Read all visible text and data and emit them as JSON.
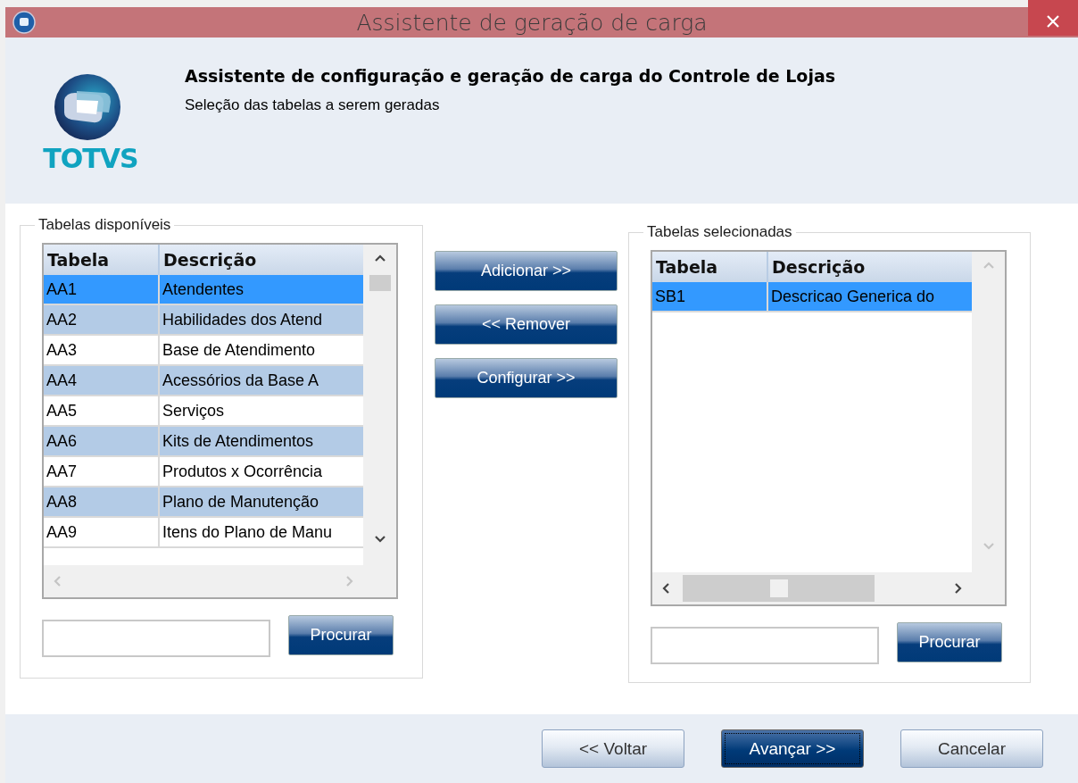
{
  "window": {
    "title": "Assistente de geração de carga"
  },
  "header": {
    "logo_text": "TOTVS",
    "title": "Assistente de configuração e geração de carga do Controle de Lojas",
    "subtitle": "Seleção das tabelas a serem geradas"
  },
  "available": {
    "label": "Tabelas disponíveis",
    "columns": [
      "Tabela",
      "Descrição"
    ],
    "rows": [
      {
        "cells": [
          "AA1",
          "Atendentes"
        ],
        "selected": true
      },
      {
        "cells": [
          "AA2",
          "Habilidades dos Atend"
        ],
        "selected": false
      },
      {
        "cells": [
          "AA3",
          "Base de Atendimento"
        ],
        "selected": false
      },
      {
        "cells": [
          "AA4",
          "Acessórios da Base A"
        ],
        "selected": false
      },
      {
        "cells": [
          "AA5",
          "Serviços"
        ],
        "selected": false
      },
      {
        "cells": [
          "AA6",
          "Kits de Atendimentos"
        ],
        "selected": false
      },
      {
        "cells": [
          "AA7",
          "Produtos x Ocorrência"
        ],
        "selected": false
      },
      {
        "cells": [
          "AA8",
          "Plano de Manutenção"
        ],
        "selected": false
      },
      {
        "cells": [
          "AA9",
          "Itens do Plano de Manu"
        ],
        "selected": false
      }
    ],
    "search_button": "Procurar"
  },
  "actions": [
    {
      "label": "Adicionar >>"
    },
    {
      "label": "<< Remover"
    },
    {
      "label": "Configurar >>"
    }
  ],
  "selected_tables": {
    "label": "Tabelas selecionadas",
    "columns": [
      "Tabela",
      "Descrição"
    ],
    "rows": [
      {
        "cells": [
          "SB1",
          "Descricao Generica do"
        ],
        "selected": true
      }
    ],
    "search_button": "Procurar"
  },
  "footer": [
    {
      "label": "<< Voltar",
      "kind": "normal"
    },
    {
      "label": "Avançar >>",
      "kind": "default"
    },
    {
      "label": "Cancelar",
      "kind": "normal"
    }
  ]
}
